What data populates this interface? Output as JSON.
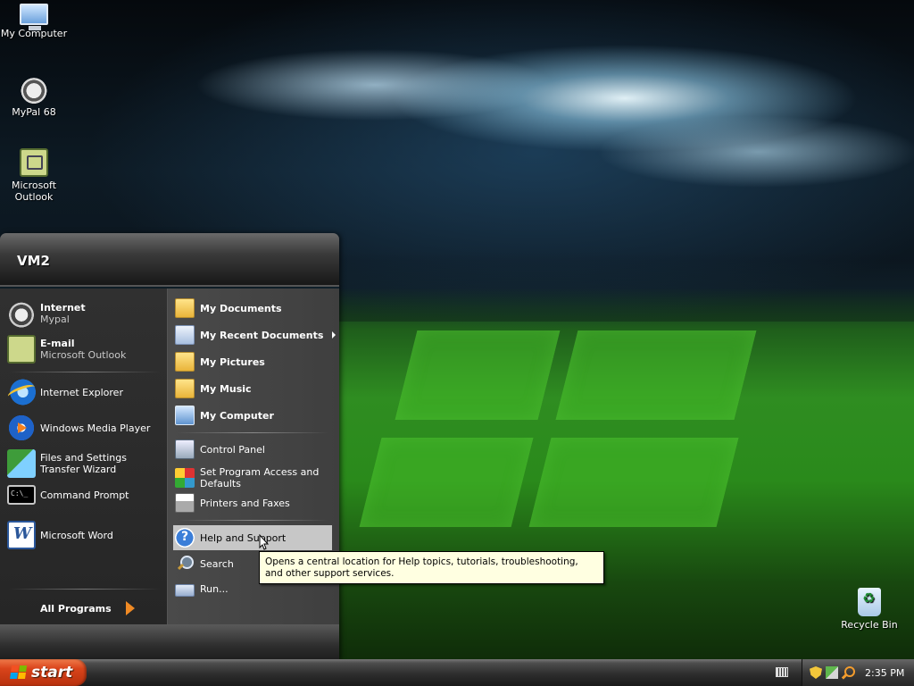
{
  "desktop": {
    "icons": [
      {
        "label": "My Computer",
        "icon": "my-computer-icon"
      },
      {
        "label": "MyPal 68",
        "icon": "mypal-raccoon-icon"
      },
      {
        "label": "Microsoft Outlook",
        "icon": "outlook-icon"
      },
      {
        "label": "Recycle Bin",
        "icon": "recycle-bin-icon"
      }
    ]
  },
  "start_menu": {
    "user": "VM2",
    "left": {
      "pinned": [
        {
          "primary": "Internet",
          "secondary": "Mypal",
          "icon": "mypal-raccoon-icon"
        },
        {
          "primary": "E-mail",
          "secondary": "Microsoft Outlook",
          "icon": "outlook-icon"
        }
      ],
      "recent": [
        {
          "label": "Internet Explorer",
          "icon": "internet-explorer-icon"
        },
        {
          "label": "Windows Media Player",
          "icon": "media-player-icon"
        },
        {
          "label": "Files and Settings Transfer Wizard",
          "icon": "transfer-wizard-icon"
        },
        {
          "label": "Command Prompt",
          "icon": "command-prompt-icon"
        },
        {
          "label": "Microsoft Word",
          "icon": "word-icon"
        }
      ],
      "all_programs": "All Programs"
    },
    "right": {
      "places": [
        {
          "label": "My Documents",
          "icon": "folder-icon"
        },
        {
          "label": "My Recent Documents",
          "icon": "recent-documents-icon"
        },
        {
          "label": "My Pictures",
          "icon": "folder-icon"
        },
        {
          "label": "My Music",
          "icon": "folder-icon"
        },
        {
          "label": "My Computer",
          "icon": "computer-icon"
        }
      ],
      "settings": [
        {
          "label": "Control Panel",
          "icon": "control-panel-icon"
        },
        {
          "label": "Set Program Access and Defaults",
          "icon": "program-defaults-icon"
        },
        {
          "label": "Printers and Faxes",
          "icon": "printer-icon"
        }
      ],
      "tools": [
        {
          "label": "Help and Support",
          "icon": "help-icon"
        },
        {
          "label": "Search",
          "icon": "search-icon"
        },
        {
          "label": "Run...",
          "icon": "run-icon"
        }
      ]
    }
  },
  "tooltip": {
    "text": "Opens a central location for Help topics, tutorials, troubleshooting, and other support services."
  },
  "taskbar": {
    "start_label": "start",
    "clock": "2:35 PM",
    "colors": {
      "start_button": "#d9441b",
      "taskbar": "#2e2e2e"
    }
  }
}
